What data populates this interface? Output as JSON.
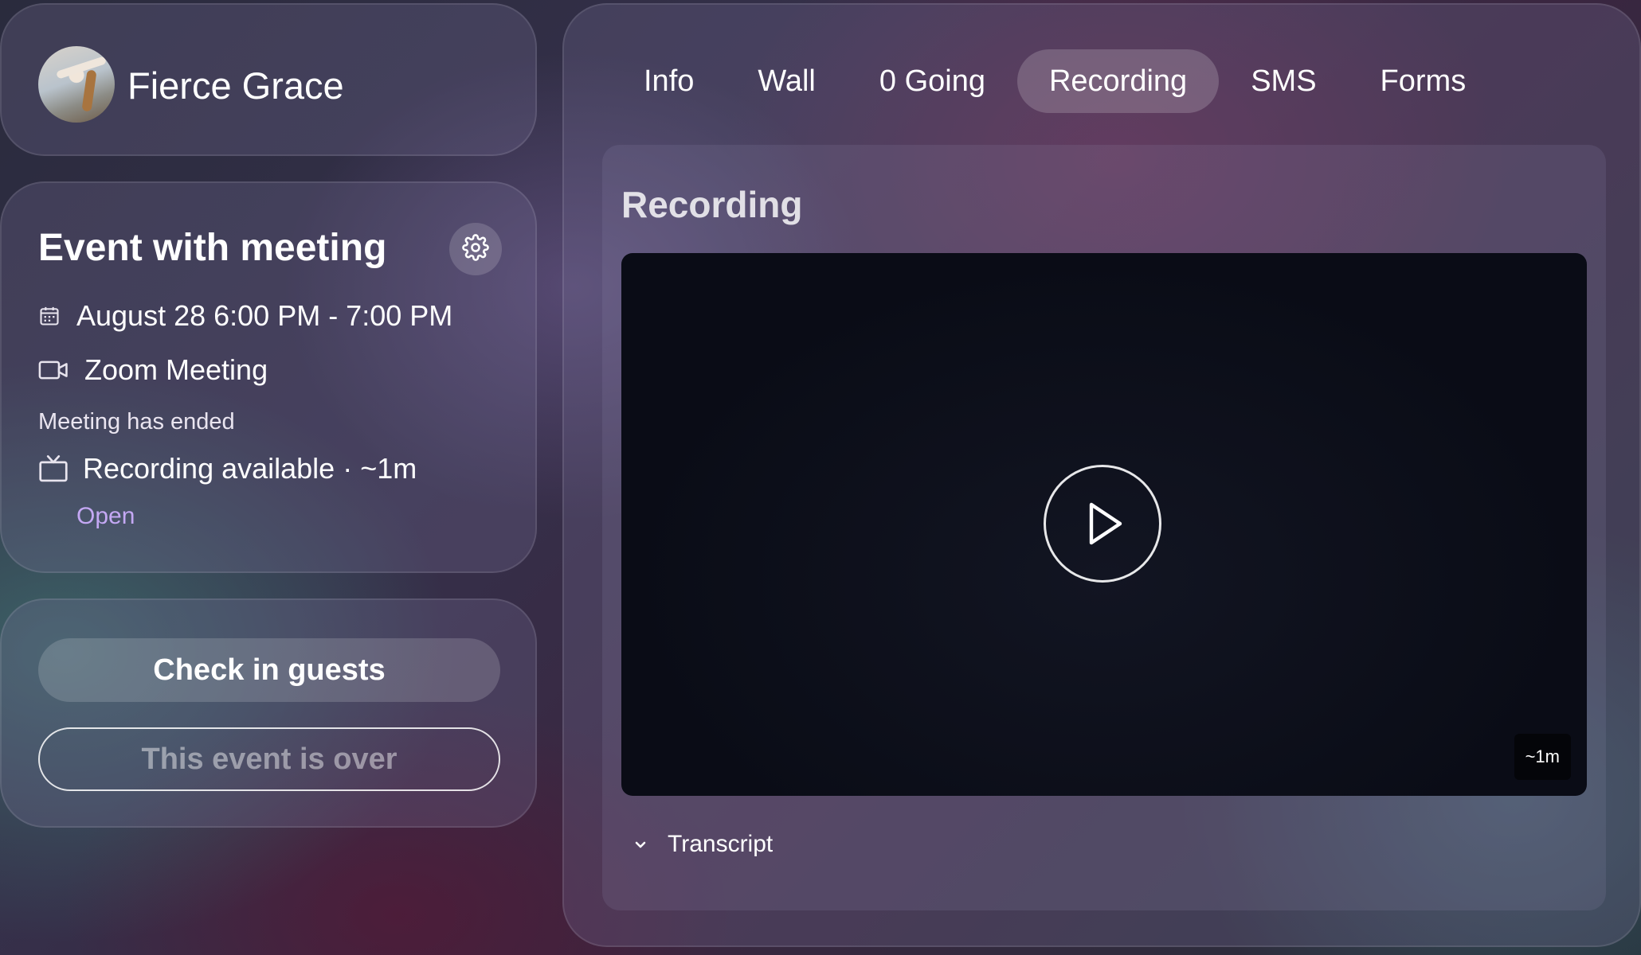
{
  "profile": {
    "name": "Fierce Grace"
  },
  "event": {
    "title": "Event with meeting",
    "datetime": "August 28 6:00 PM - 7:00 PM",
    "meeting_type": "Zoom Meeting",
    "meeting_status": "Meeting has ended",
    "recording_status": "Recording available · ~1m",
    "open_link": "Open"
  },
  "actions": {
    "check_in_label": "Check in guests",
    "event_over_label": "This event is over"
  },
  "tabs": [
    {
      "label": "Info",
      "active": false
    },
    {
      "label": "Wall",
      "active": false
    },
    {
      "label": "0 Going",
      "active": false
    },
    {
      "label": "Recording",
      "active": true
    },
    {
      "label": "SMS",
      "active": false
    },
    {
      "label": "Forms",
      "active": false
    }
  ],
  "recording": {
    "title": "Recording",
    "duration": "~1m",
    "transcript_label": "Transcript"
  },
  "colors": {
    "accent_link": "#c4a8f4"
  },
  "icons": {
    "settings": "gear-icon",
    "date": "calendar-icon",
    "meeting": "video-camera-icon",
    "recording": "tv-icon",
    "play": "play-icon",
    "transcript": "chevron-down-icon"
  }
}
